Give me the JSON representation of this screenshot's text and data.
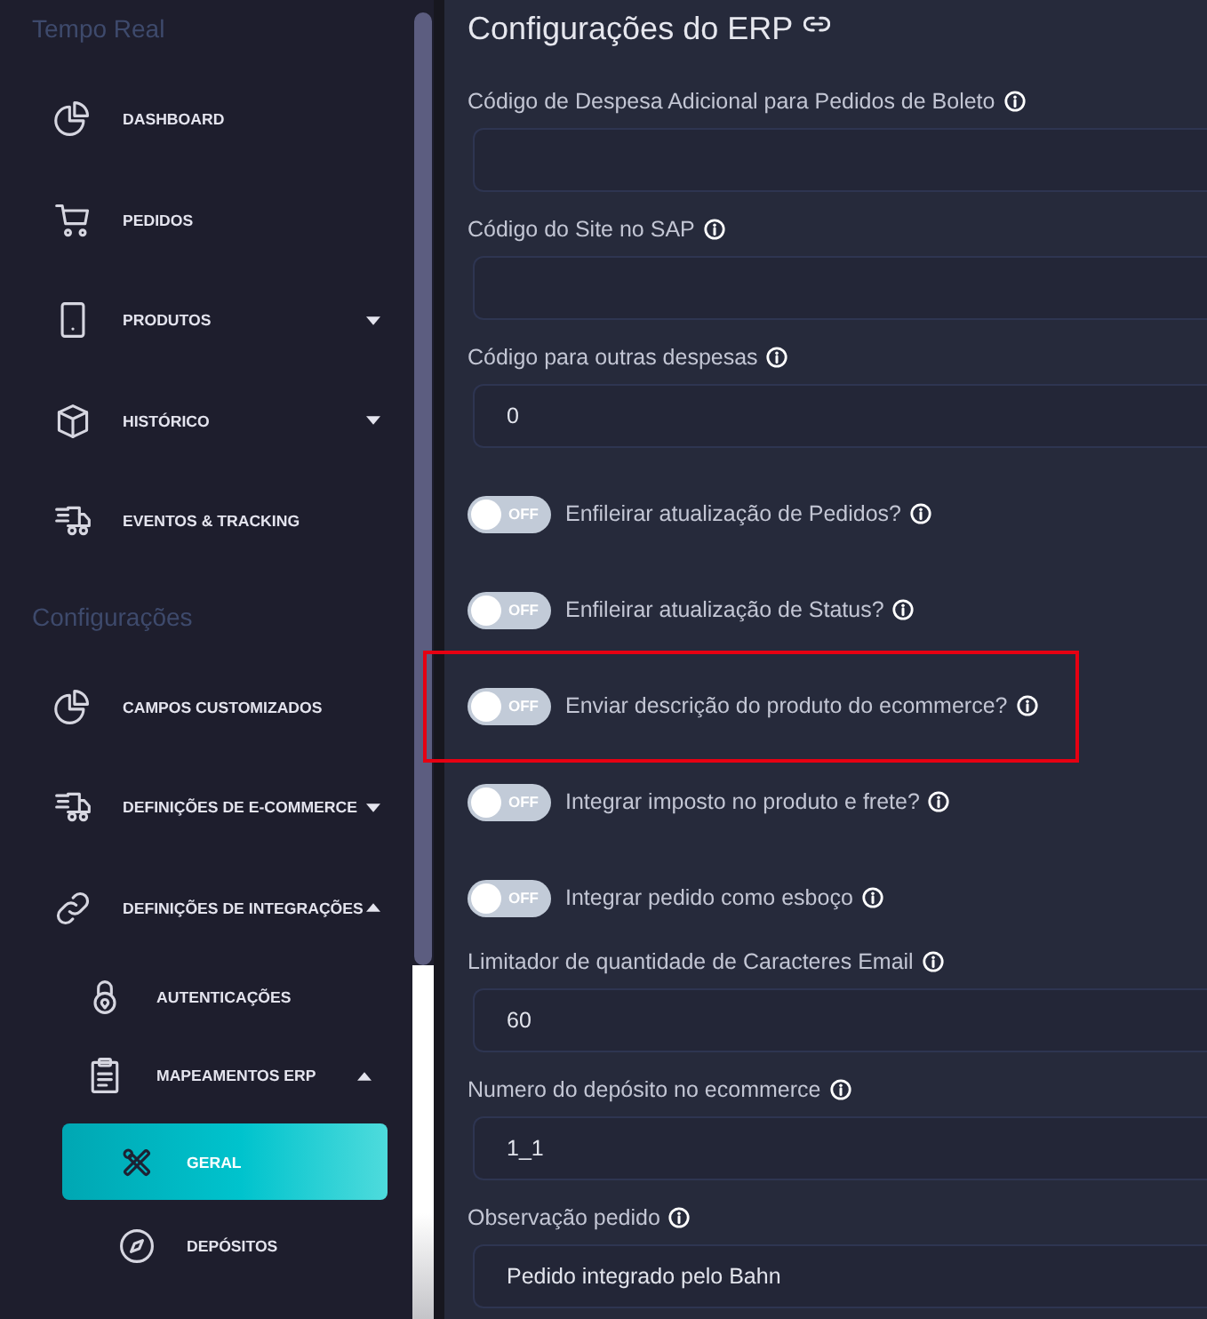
{
  "sidebar": {
    "sections": [
      {
        "title": "Tempo Real",
        "items": [
          {
            "label": "DASHBOARD",
            "selected": false
          },
          {
            "label": "PEDIDOS",
            "selected": false
          },
          {
            "label": "PRODUTOS",
            "selected": false,
            "expanded": false
          },
          {
            "label": "HISTÓRICO",
            "selected": false,
            "expanded": false
          },
          {
            "label": "EVENTOS & TRACKING",
            "selected": false
          }
        ]
      },
      {
        "title": "Configurações",
        "items": [
          {
            "label": "CAMPOS CUSTOMIZADOS",
            "selected": false
          },
          {
            "label": "DEFINIÇÕES DE E-COMMERCE",
            "selected": false,
            "expanded": false
          },
          {
            "label": "DEFINIÇÕES DE INTEGRAÇÕES",
            "selected": false,
            "expanded": true,
            "children": [
              {
                "label": "AUTENTICAÇÕES",
                "selected": false
              },
              {
                "label": "MAPEAMENTOS ERP",
                "selected": false,
                "expanded": true,
                "children": [
                  {
                    "label": "GERAL",
                    "selected": true
                  },
                  {
                    "label": "DEPÓSITOS",
                    "selected": false
                  }
                ]
              }
            ]
          }
        ]
      }
    ]
  },
  "main": {
    "title": "Configurações do ERP",
    "settings": [
      {
        "kind": "input",
        "label": "Código de Despesa Adicional para Pedidos de Boleto"
      },
      {
        "kind": "input",
        "label": "Código do Site no SAP"
      },
      {
        "kind": "input",
        "label": "Código para outras despesas",
        "value": "0"
      },
      {
        "kind": "toggle",
        "label": "Enfileirar atualização de Pedidos?",
        "on": false,
        "state_text": "OFF",
        "highlighted": false
      },
      {
        "kind": "toggle",
        "label": "Enfileirar atualização de Status?",
        "on": false,
        "state_text": "OFF",
        "highlighted": false
      },
      {
        "kind": "toggle",
        "label": "Enviar descrição do produto do ecommerce?",
        "on": false,
        "state_text": "OFF",
        "highlighted": true
      },
      {
        "kind": "toggle",
        "label": "Integrar imposto no produto e frete?",
        "on": false,
        "state_text": "OFF",
        "highlighted": false
      },
      {
        "kind": "toggle",
        "label": "Integrar pedido como esboço",
        "on": false,
        "state_text": "OFF",
        "highlighted": false
      },
      {
        "kind": "input",
        "label": "Limitador de quantidade de Caracteres Email",
        "value": "60"
      },
      {
        "kind": "input",
        "label": "Numero do depósito no ecommerce",
        "value": "1_1"
      },
      {
        "kind": "input",
        "label": "Observação pedido",
        "value": "Pedido integrado pelo Bahn"
      }
    ]
  }
}
